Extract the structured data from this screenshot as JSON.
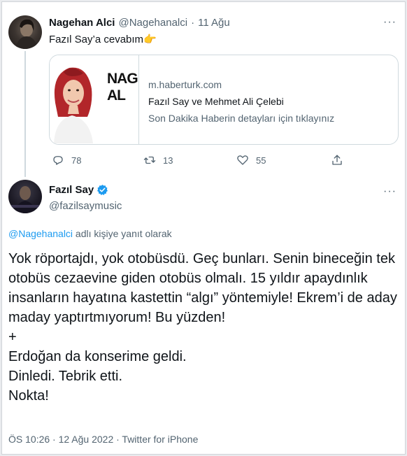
{
  "reply_tweet": {
    "author_name": "Nagehan Alci",
    "author_handle": "@Nagehanalci",
    "separator": "·",
    "date": "11 Ağu",
    "text": "Fazıl Say’a cevabım",
    "emoji": "👉",
    "more_icon": "more-dots-icon",
    "link_card": {
      "image_brand": "NAG\nAL",
      "domain": "m.haberturk.com",
      "title": "Fazıl Say ve Mehmet Ali Çelebi",
      "description": "Son Dakika Haberin detayları için tıklayınız"
    },
    "actions": {
      "replies": "78",
      "retweets": "13",
      "likes": "55"
    }
  },
  "main_tweet": {
    "author_name": "Fazıl Say",
    "author_handle": "@fazilsaymusic",
    "verified": true,
    "reply_mention": "@Nagehanalci",
    "reply_suffix": " adlı kişiye yanıt olarak",
    "lines": [
      "Yok röportajdı, yok otobüsdü. Geç bunları. Senin bineceğin tek otobüs cezaevine giden otobüs olmalı. 15 yıldır apaydınlık insanların hayatına kastettin “algı” yöntemiyle! Ekrem’i de aday maday yaptırtmıyorum! Bu yüzden!",
      "+",
      "Erdoğan da konserime geldi.",
      "Dinledi. Tebrik etti.",
      "Nokta!"
    ],
    "timestamp": "ÖS 10:26 · 12 Ağu 2022 · Twitter for iPhone"
  },
  "colors": {
    "link": "#1d9bf0",
    "muted": "#536471",
    "text": "#0f1419",
    "border": "#cfd9de"
  }
}
